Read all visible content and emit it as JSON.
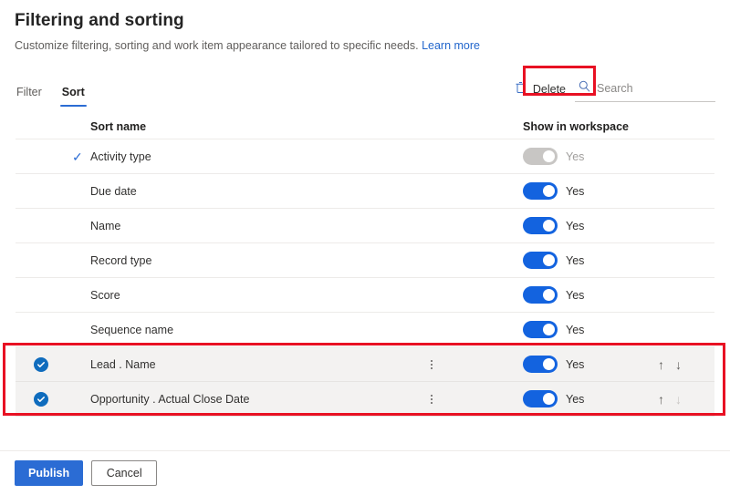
{
  "header": {
    "title": "Filtering and sorting",
    "subtitle": "Customize filtering, sorting and work item appearance tailored to specific needs.",
    "learn_more": "Learn more"
  },
  "tabs": [
    {
      "label": "Filter",
      "active": false
    },
    {
      "label": "Sort",
      "active": true
    }
  ],
  "toolbar": {
    "delete_label": "Delete",
    "delete_icon": "trash-icon",
    "search_icon": "search-icon",
    "search_placeholder": "Search",
    "search_value": ""
  },
  "table": {
    "columns": {
      "sort_name": "Sort name",
      "show_in_workspace": "Show in workspace"
    },
    "rows": [
      {
        "name": "Activity type",
        "marker": "check",
        "selected": false,
        "has_more": false,
        "toggle_on": true,
        "toggle_disabled": true,
        "toggle_label": "Yes",
        "arrows": false
      },
      {
        "name": "Due date",
        "marker": "none",
        "selected": false,
        "has_more": false,
        "toggle_on": true,
        "toggle_disabled": false,
        "toggle_label": "Yes",
        "arrows": false
      },
      {
        "name": "Name",
        "marker": "none",
        "selected": false,
        "has_more": false,
        "toggle_on": true,
        "toggle_disabled": false,
        "toggle_label": "Yes",
        "arrows": false
      },
      {
        "name": "Record type",
        "marker": "none",
        "selected": false,
        "has_more": false,
        "toggle_on": true,
        "toggle_disabled": false,
        "toggle_label": "Yes",
        "arrows": false
      },
      {
        "name": "Score",
        "marker": "none",
        "selected": false,
        "has_more": false,
        "toggle_on": true,
        "toggle_disabled": false,
        "toggle_label": "Yes",
        "arrows": false
      },
      {
        "name": "Sequence name",
        "marker": "none",
        "selected": false,
        "has_more": false,
        "toggle_on": true,
        "toggle_disabled": false,
        "toggle_label": "Yes",
        "arrows": false
      },
      {
        "name": "Lead . Name",
        "marker": "checkbox",
        "selected": true,
        "has_more": true,
        "toggle_on": true,
        "toggle_disabled": false,
        "toggle_label": "Yes",
        "arrows": true,
        "arrow_up_disabled": false,
        "arrow_down_disabled": false
      },
      {
        "name": "Opportunity . Actual Close Date",
        "marker": "checkbox",
        "selected": true,
        "has_more": true,
        "toggle_on": true,
        "toggle_disabled": false,
        "toggle_label": "Yes",
        "arrows": true,
        "arrow_up_disabled": false,
        "arrow_down_disabled": true
      }
    ]
  },
  "footer": {
    "publish_label": "Publish",
    "cancel_label": "Cancel"
  },
  "annotations": {
    "accent_red": "#e81123",
    "accent_blue": "#2b6cd4",
    "toggle_blue": "#1363df",
    "checkbox_blue": "#0f6cbd",
    "selected_row_bg": "#f3f2f1"
  },
  "icons": {
    "arrow_up": "↑",
    "arrow_down": "↓",
    "check": "✓"
  }
}
